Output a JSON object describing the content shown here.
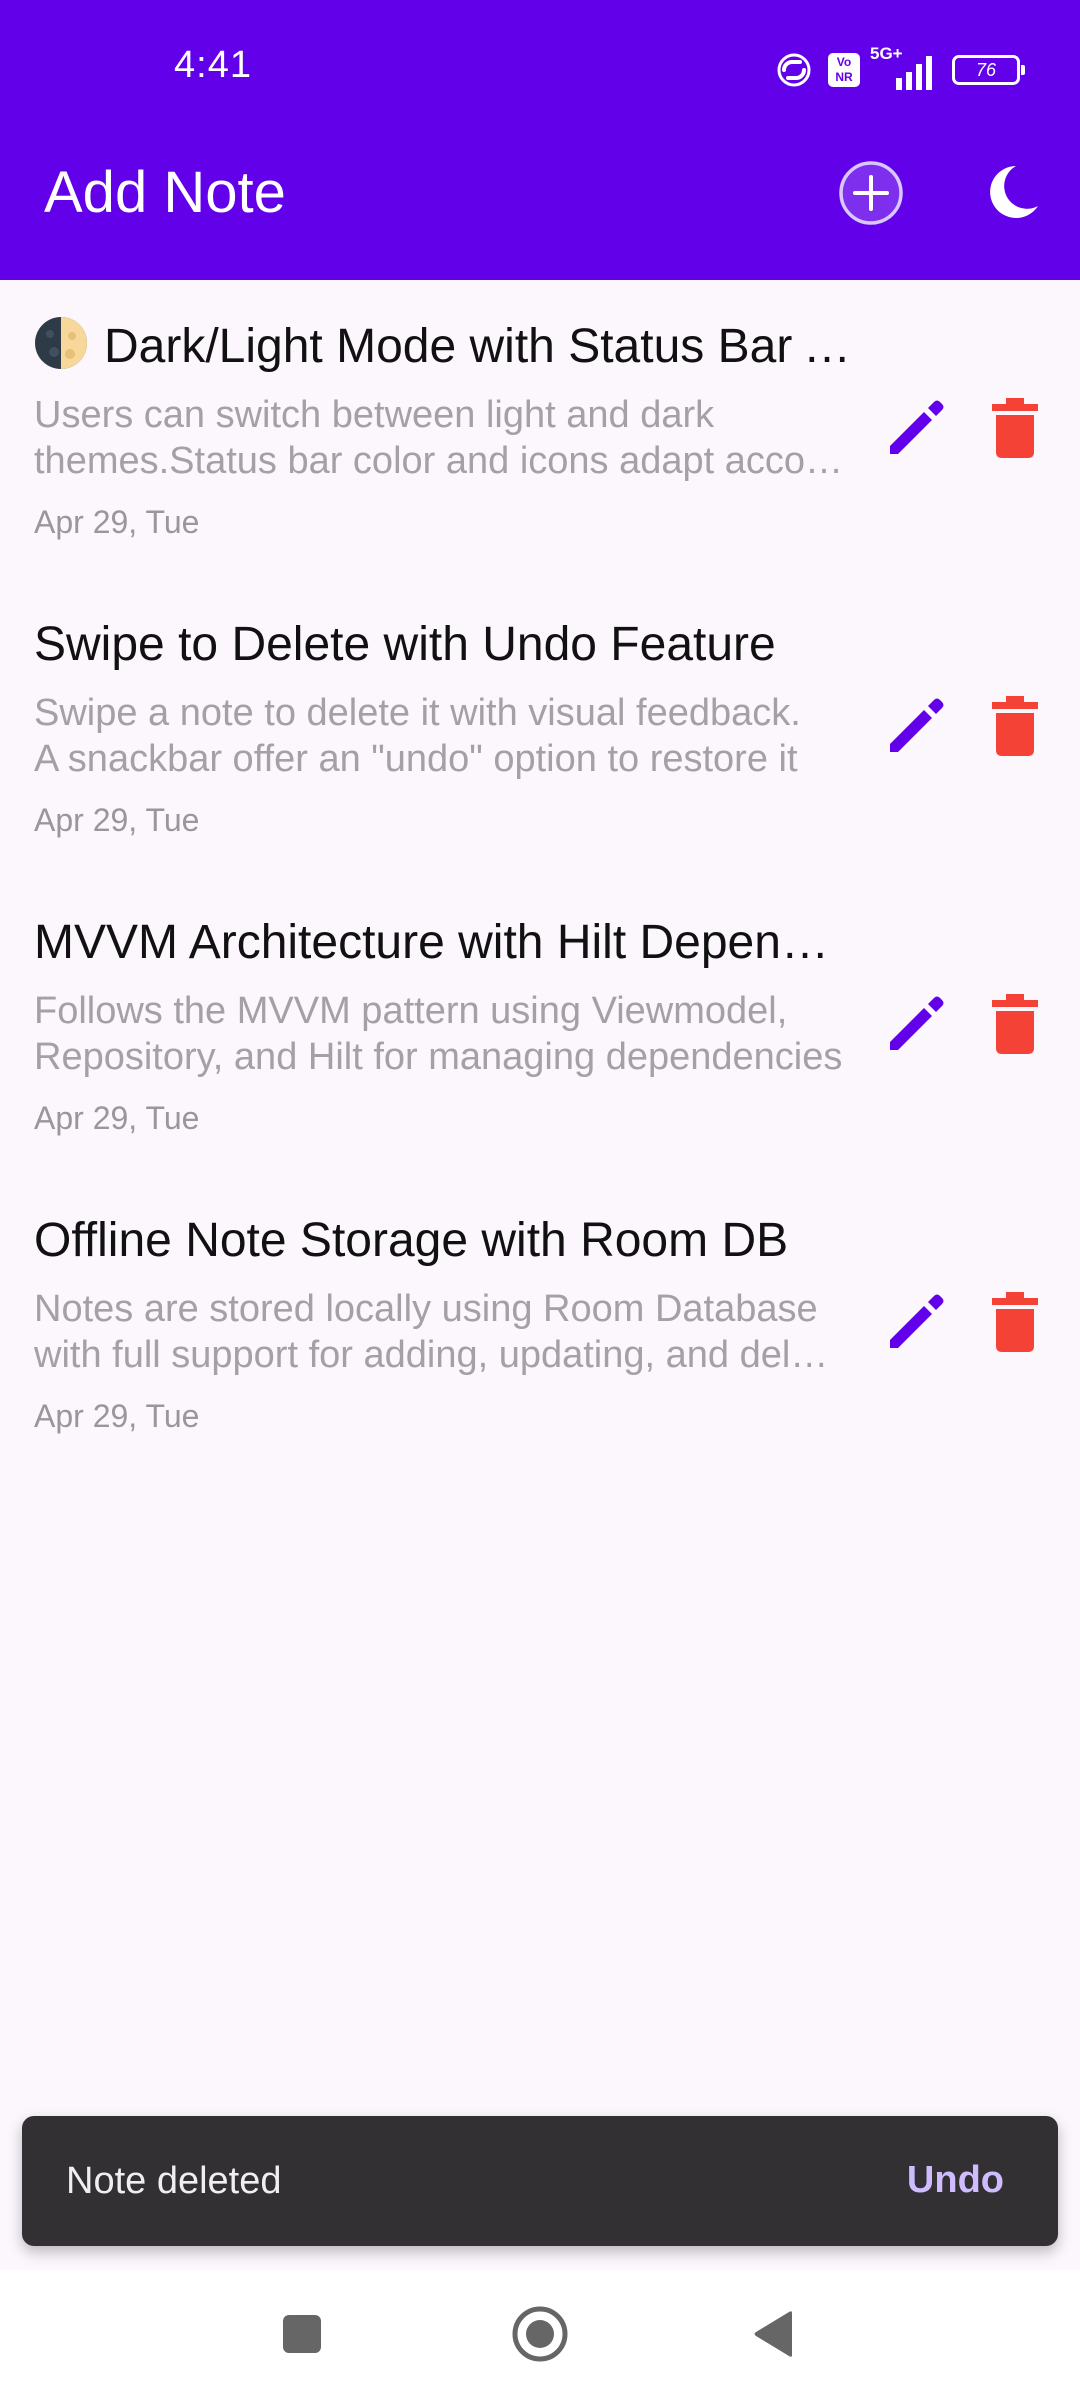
{
  "status_bar": {
    "time": "4:41",
    "volte_label": "Vo NR",
    "network_label": "5G+",
    "battery_level": "76"
  },
  "app_bar": {
    "title": "Add Note",
    "add_icon": "add-circle-icon",
    "theme_icon": "moon-icon"
  },
  "notes": [
    {
      "emoji": "moon-emoji",
      "title": "Dark/Light Mode with Status Bar Adaptation",
      "description_line1": "Users can switch between light and dark",
      "description_line2": "themes.Status bar color and icons adapt accordingly",
      "date": "Apr 29, Tue"
    },
    {
      "title": "Swipe to Delete with Undo Feature",
      "description_line1": "Swipe a note to delete it with visual feedback.",
      "description_line2": "A snackbar offer an \"undo\" option to restore it",
      "date": "Apr 29, Tue"
    },
    {
      "title": "MVVM Architecture with Hilt Dependency Injection",
      "description_line1": "Follows the MVVM pattern using Viewmodel,",
      "description_line2": "Repository, and Hilt for managing dependencies",
      "date": "Apr 29, Tue"
    },
    {
      "title": "Offline Note Storage with Room DB",
      "description_line1": "Notes are stored locally using Room Database",
      "description_line2": "with full support for adding, updating, and deleting",
      "date": "Apr 29, Tue"
    }
  ],
  "snackbar": {
    "message": "Note deleted",
    "action": "Undo"
  },
  "colors": {
    "primary": "#6200ea",
    "edit_icon": "#6200ea",
    "delete_icon": "#f44336",
    "background": "#fcf6fd",
    "snackbar_bg": "#323033",
    "snackbar_action": "#cfbcff"
  }
}
